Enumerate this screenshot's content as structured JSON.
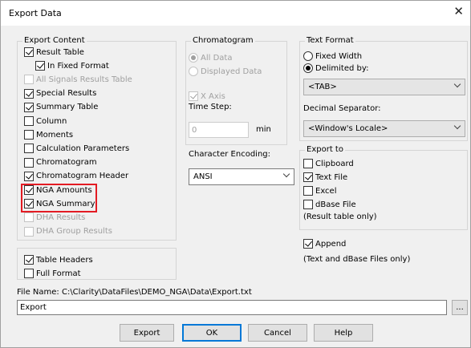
{
  "window": {
    "title": "Export Data",
    "close_icon": "close-icon"
  },
  "export_content": {
    "label": "Export Content",
    "items": [
      {
        "label": "Result Table",
        "checked": true,
        "enabled": true
      },
      {
        "label": "In Fixed Format",
        "checked": true,
        "enabled": true
      },
      {
        "label": "All Signals Results Table",
        "checked": false,
        "enabled": false
      },
      {
        "label": "Special Results",
        "checked": true,
        "enabled": true
      },
      {
        "label": "Summary Table",
        "checked": true,
        "enabled": true
      },
      {
        "label": "Column",
        "checked": false,
        "enabled": true
      },
      {
        "label": "Moments",
        "checked": false,
        "enabled": true
      },
      {
        "label": "Calculation Parameters",
        "checked": false,
        "enabled": true
      },
      {
        "label": "Chromatogram",
        "checked": false,
        "enabled": true
      },
      {
        "label": "Chromatogram Header",
        "checked": true,
        "enabled": true
      },
      {
        "label": "NGA Amounts",
        "checked": true,
        "enabled": true
      },
      {
        "label": "NGA Summary",
        "checked": true,
        "enabled": true
      },
      {
        "label": "DHA Results",
        "checked": false,
        "enabled": false
      },
      {
        "label": "DHA Group Results",
        "checked": false,
        "enabled": false
      }
    ],
    "highlight_color": "#e31b23"
  },
  "headers_group": {
    "items": [
      {
        "label": "Table Headers",
        "checked": true
      },
      {
        "label": "Full Format",
        "checked": false
      }
    ]
  },
  "chromatogram": {
    "label": "Chromatogram",
    "all_data": "All Data",
    "displayed_data": "Displayed Data",
    "x_axis": "X Axis",
    "time_step_label": "Time Step:",
    "time_step_value": "0",
    "time_unit": "min"
  },
  "character_encoding": {
    "label": "Character Encoding:",
    "value": "ANSI"
  },
  "text_format": {
    "label": "Text Format",
    "fixed_width": "Fixed Width",
    "delimited_by": "Delimited by:",
    "delimiter_value": "<TAB>",
    "decimal_separator_label": "Decimal Separator:",
    "decimal_separator_value": "<Window's Locale>"
  },
  "export_to": {
    "label": "Export to",
    "items": [
      {
        "label": "Clipboard",
        "checked": false
      },
      {
        "label": "Text File",
        "checked": true
      },
      {
        "label": "Excel",
        "checked": false
      },
      {
        "label": "dBase File",
        "checked": false
      }
    ],
    "note": "(Result table only)"
  },
  "append": {
    "label": "Append",
    "checked": true,
    "note": "(Text and dBase Files only)"
  },
  "file": {
    "label": "File Name: C:\\Clarity\\DataFiles\\DEMO_NGA\\Data\\Export.txt",
    "value": "Export",
    "browse_label": "..."
  },
  "buttons": {
    "export": "Export",
    "ok": "OK",
    "cancel": "Cancel",
    "help": "Help"
  }
}
